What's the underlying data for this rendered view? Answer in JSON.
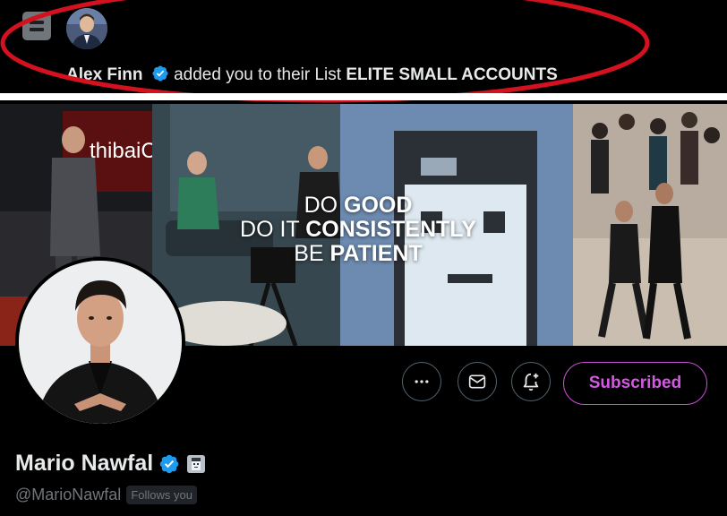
{
  "notification": {
    "icon": "list-icon",
    "user_name": "Alex Finn",
    "action_text": " added you to their List ",
    "list_name": "ELITE SMALL ACCOUNTS",
    "highlight_color": "#d4111e"
  },
  "banner": {
    "quote_line1_a": "DO ",
    "quote_line1_b": "GOOD",
    "quote_line2_a": "DO IT ",
    "quote_line2_b": "CONSISTENTLY",
    "quote_line3_a": "BE ",
    "quote_line3_b": "PATIENT",
    "sign_text": "thibaiColl"
  },
  "profile": {
    "display_name": "Mario Nawfal",
    "handle": "@MarioNawfal",
    "follows_you": "Follows you",
    "verified_color": "#1d9bf0",
    "actions": {
      "more_icon": "more-icon",
      "message_icon": "mail-icon",
      "notify_icon": "bell-plus-icon",
      "subscribed_label": "Subscribed",
      "subscribed_color": "#d657e6"
    }
  }
}
